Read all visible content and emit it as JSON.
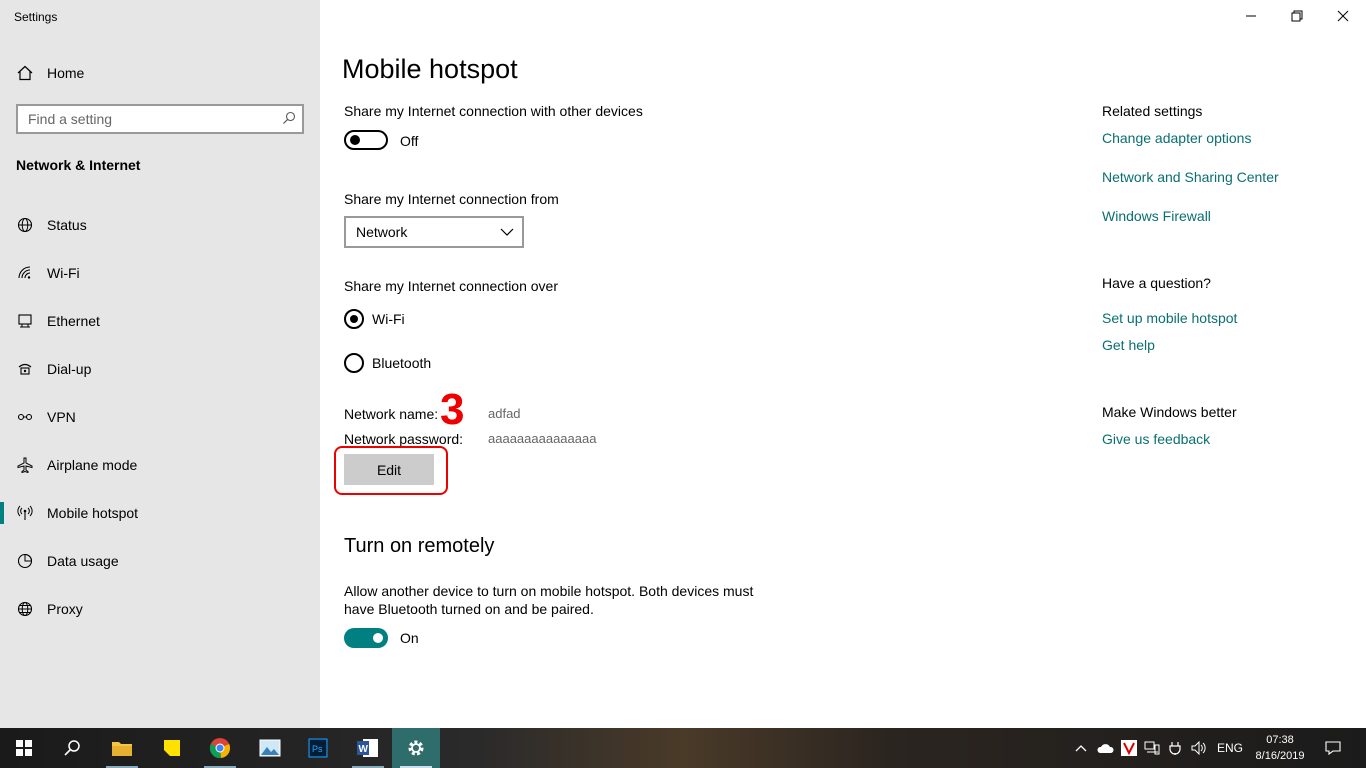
{
  "app": {
    "title": "Settings"
  },
  "sidebar": {
    "home_label": "Home",
    "search_placeholder": "Find a setting",
    "section_title": "Network & Internet",
    "items": [
      {
        "label": "Status",
        "icon": "globe-icon"
      },
      {
        "label": "Wi-Fi",
        "icon": "wifi-icon"
      },
      {
        "label": "Ethernet",
        "icon": "ethernet-icon"
      },
      {
        "label": "Dial-up",
        "icon": "dialup-icon"
      },
      {
        "label": "VPN",
        "icon": "vpn-icon"
      },
      {
        "label": "Airplane mode",
        "icon": "airplane-icon"
      },
      {
        "label": "Mobile hotspot",
        "icon": "hotspot-icon",
        "selected": true
      },
      {
        "label": "Data usage",
        "icon": "data-usage-icon"
      },
      {
        "label": "Proxy",
        "icon": "proxy-globe-icon"
      }
    ]
  },
  "main": {
    "title": "Mobile hotspot",
    "share_label": "Share my Internet connection with other devices",
    "share_toggle": {
      "state": "Off",
      "on": false
    },
    "share_from_label": "Share my Internet connection from",
    "share_from_value": "Network",
    "share_over_label": "Share my Internet connection over",
    "share_over_options": [
      {
        "label": "Wi-Fi",
        "selected": true
      },
      {
        "label": "Bluetooth",
        "selected": false
      }
    ],
    "network_name_label": "Network name:",
    "network_name_value": "adfad",
    "network_password_label": "Network password:",
    "network_password_value": "aaaaaaaaaaaaaaa",
    "edit_label": "Edit",
    "annotation_number": "3",
    "remote_title": "Turn on remotely",
    "remote_desc": "Allow another device to turn on mobile hotspot. Both devices must have Bluetooth turned on and be paired.",
    "remote_toggle": {
      "state": "On",
      "on": true
    }
  },
  "right": {
    "related_title": "Related settings",
    "related_links": [
      "Change adapter options",
      "Network and Sharing Center",
      "Windows Firewall"
    ],
    "question_title": "Have a question?",
    "question_links": [
      "Set up mobile hotspot",
      "Get help"
    ],
    "better_title": "Make Windows better",
    "better_links": [
      "Give us feedback"
    ]
  },
  "taskbar": {
    "language": "ENG",
    "time": "07:38",
    "date": "8/16/2019",
    "colors": {
      "accent": "#008080",
      "link": "#0a6f70",
      "annotation": "#e00000"
    }
  }
}
